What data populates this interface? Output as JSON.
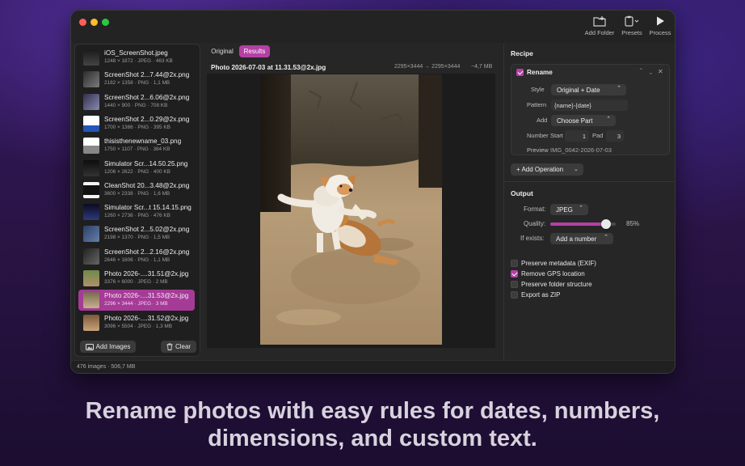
{
  "toolbar": {
    "add_folder": "Add Folder",
    "presets": "Presets",
    "process": "Process"
  },
  "sidebar": {
    "files": [
      {
        "name": "iOS_ScreenShot.jpeg",
        "meta": "1248 × 1872 · JPEG · 463 KB"
      },
      {
        "name": "ScreenShot 2...7.44@2x.png",
        "meta": "2182 × 1358 · PNG · 1,1 MB"
      },
      {
        "name": "ScreenShot 2...6.06@2x.png",
        "meta": "1440 × 900 · PNG · 708 KB"
      },
      {
        "name": "ScreenShot 2...0.29@2x.png",
        "meta": "1700 × 1366 · PNG · 395 KB"
      },
      {
        "name": "thisisthenewname_03.png",
        "meta": "1750 × 1107 · PNG · 384 KB"
      },
      {
        "name": "Simulator Scr...14.50.25.png",
        "meta": "1206 × 2622 · PNG · 400 KB"
      },
      {
        "name": "CleanShot 20...3.48@2x.png",
        "meta": "3600 × 2338 · PNG · 1,6 MB"
      },
      {
        "name": "Simulator Scr...t 15.14.15.png",
        "meta": "1260 × 2736 · PNG · 476 KB"
      },
      {
        "name": "ScreenShot 2...5.02@2x.png",
        "meta": "2198 × 1370 · PNG · 1,5 MB"
      },
      {
        "name": "ScreenShot 2...2.16@2x.png",
        "meta": "2646 × 1606 · PNG · 1,1 MB"
      },
      {
        "name": "Photo 2026-....31.51@2x.jpg",
        "meta": "3376 × 6000 · JPEG · 2 MB"
      },
      {
        "name": "Photo 2026-....31.53@2x.jpg",
        "meta": "2296 × 3444 · JPEG · 3 MB"
      },
      {
        "name": "Photo 2026-....31.52@2x.jpg",
        "meta": "3096 × 5504 · JPEG · 1,3 MB"
      }
    ],
    "selected_index": 11,
    "add_images": "Add Images",
    "clear": "Clear"
  },
  "viewer": {
    "tabs": [
      "Original",
      "Results"
    ],
    "active_tab": "Results",
    "filename": "Photo 2026-07-03 at 11.31.53@2x.jpg",
    "dims": "2295×3444 → 2295×3444",
    "size_change": "−4,7 MB"
  },
  "recipe": {
    "heading": "Recipe",
    "op_name": "Rename",
    "style_label": "Style",
    "style_value": "Original + Date",
    "pattern_label": "Pattern",
    "pattern_value": "{name}-{date}",
    "add_label": "Add",
    "add_value": "Choose Part",
    "number_label": "Number",
    "start_label": "Start",
    "start_value": "1",
    "pad_label": "Pad",
    "pad_value": "3",
    "preview_label": "Preview",
    "preview_value": "IMG_0042-2026-07-03",
    "add_operation": "+ Add Operation"
  },
  "output": {
    "heading": "Output",
    "format_label": "Format:",
    "format_value": "JPEG",
    "quality_label": "Quality:",
    "quality_value": "85%",
    "quality_fraction": 0.85,
    "exists_label": "If exists:",
    "exists_value": "Add a number",
    "options": [
      {
        "label": "Preserve metadata (EXIF)",
        "checked": false
      },
      {
        "label": "Remove GPS location",
        "checked": true
      },
      {
        "label": "Preserve folder structure",
        "checked": false
      },
      {
        "label": "Export as ZIP",
        "checked": false
      }
    ]
  },
  "status": "476 images · 506,7 MB",
  "caption": {
    "line1": "Rename photos with easy rules for dates, numbers,",
    "line2": "dimensions, and custom text."
  },
  "colors": {
    "accent": "#b540a5",
    "selection": "#a53b97"
  }
}
